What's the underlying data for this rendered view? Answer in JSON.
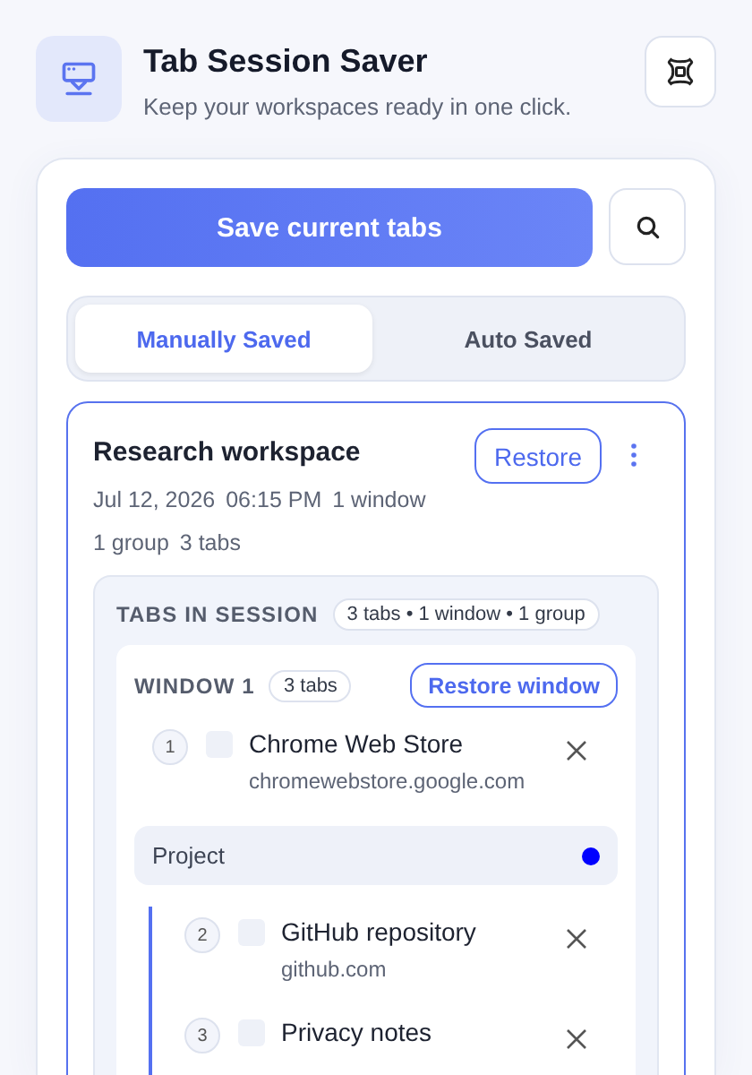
{
  "header": {
    "title": "Tab Session Saver",
    "subtitle": "Keep your workspaces ready in one click."
  },
  "save_button": "Save current tabs",
  "tabs": [
    {
      "label": "Manually Saved",
      "selected": true
    },
    {
      "label": "Auto Saved",
      "selected": false
    }
  ],
  "sessions": [
    {
      "name": "Research workspace",
      "date": "Jul 12, 2026",
      "time": "06:15 PM",
      "windows": "1 window",
      "groups": "1 group",
      "tab_count": "3 tabs",
      "restore": "Restore",
      "panel": {
        "heading": "TABS IN SESSION",
        "summary": "3 tabs • 1 window • 1 group",
        "windows": [
          {
            "label": "WINDOW 1",
            "count": "3 tabs",
            "restore": "Restore window",
            "items": [
              {
                "kind": "tab",
                "number": "1",
                "title": "Chrome Web Store",
                "url": "chromewebstore.google.com"
              },
              {
                "kind": "group",
                "name": "Project",
                "color": "#0000ff",
                "children": [
                  {
                    "kind": "tab",
                    "number": "2",
                    "title": "GitHub repository",
                    "url": "github.com"
                  },
                  {
                    "kind": "tab",
                    "number": "3",
                    "title": "Privacy notes"
                  }
                ]
              }
            ]
          }
        ]
      }
    }
  ]
}
